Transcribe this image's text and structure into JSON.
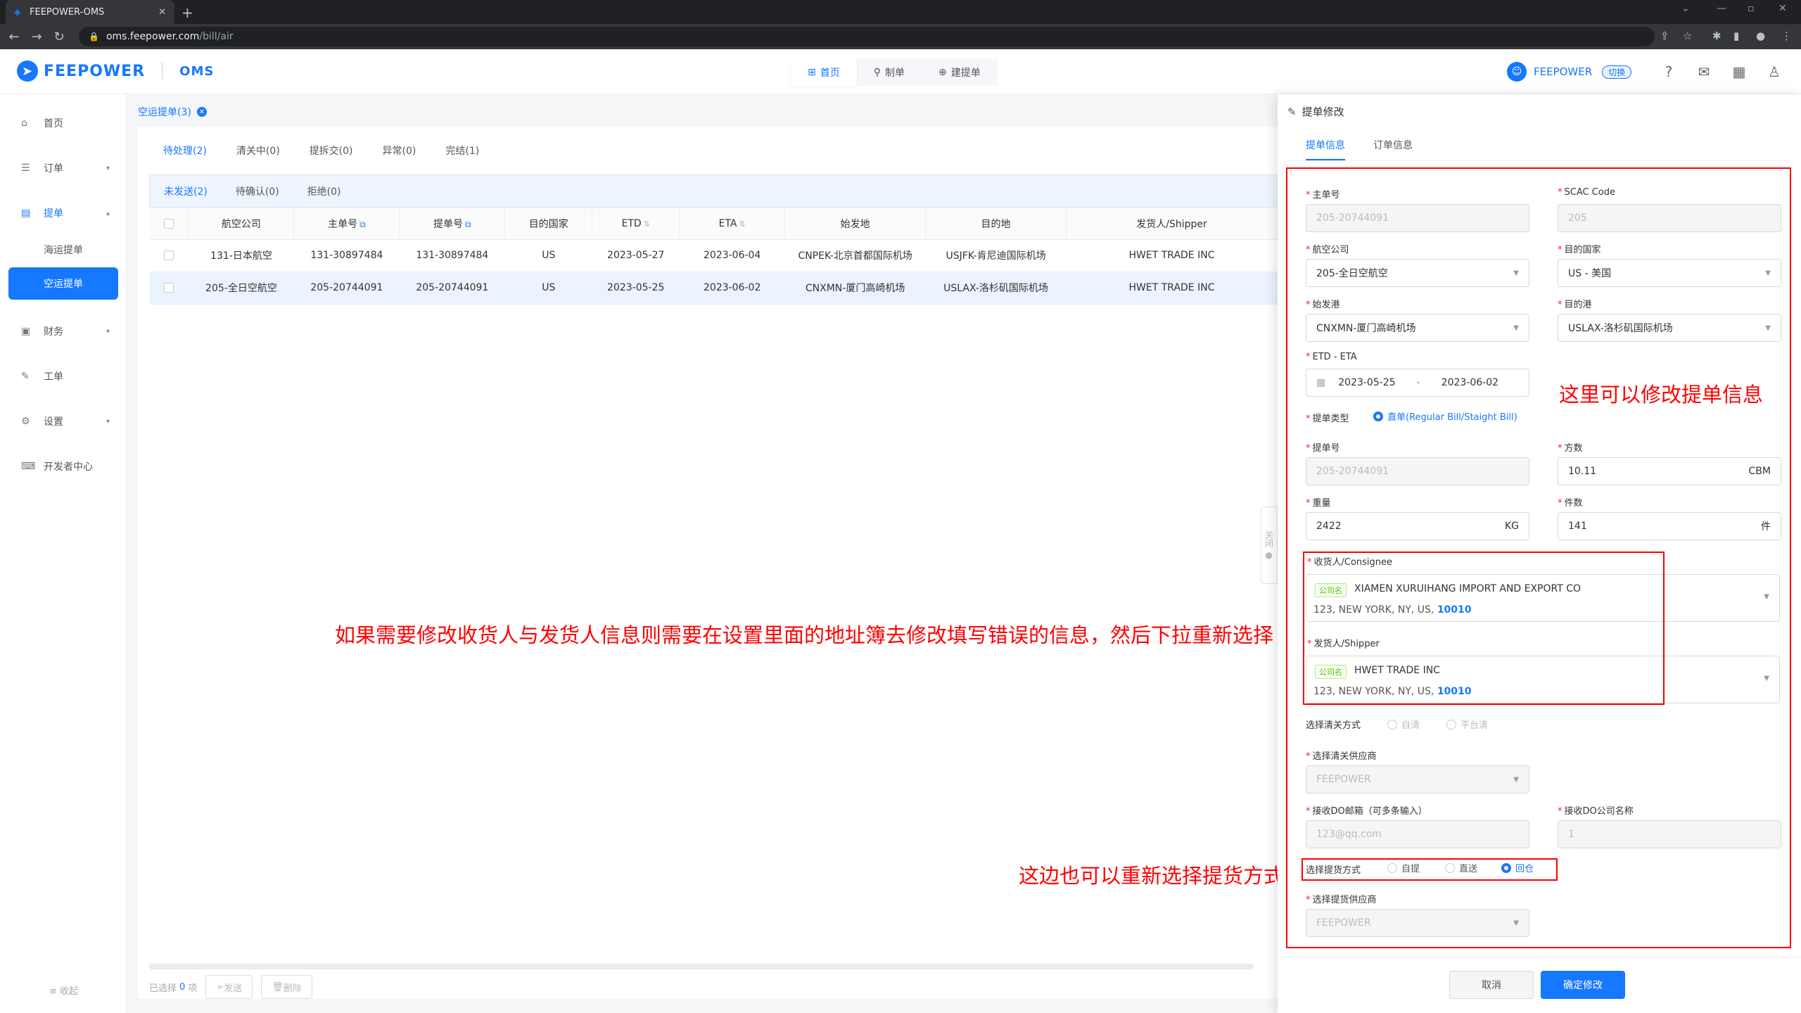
{
  "browser": {
    "tab_title": "FEEPOWER-OMS",
    "url_host": "oms.feepower.com",
    "url_path": "/bill/air"
  },
  "header": {
    "logo_text": "FEEPOWER",
    "product": "OMS",
    "nav": [
      {
        "label": "首页",
        "icon": "grid-icon"
      },
      {
        "label": "制单",
        "icon": "stamp-icon"
      },
      {
        "label": "建提单",
        "icon": "doc-plus-icon"
      }
    ],
    "user": "FEEPOWER",
    "switch_label": "切换"
  },
  "sidebar": {
    "items": [
      {
        "label": "首页"
      },
      {
        "label": "订单"
      },
      {
        "label": "提单"
      },
      {
        "label": "海运提单"
      },
      {
        "label": "空运提单"
      },
      {
        "label": "财务"
      },
      {
        "label": "工单"
      },
      {
        "label": "设置"
      },
      {
        "label": "开发者中心"
      }
    ],
    "collapse_label": "收起"
  },
  "page": {
    "tab_label": "空运提单(3)",
    "status_tabs": [
      "待处理(2)",
      "清关中(0)",
      "提拆交(0)",
      "异常(0)",
      "完结(1)"
    ],
    "sub_tabs": [
      "未发送(2)",
      "待确认(0)",
      "拒绝(0)"
    ]
  },
  "table": {
    "headers": [
      "航空公司",
      "主单号",
      "提单号",
      "目的国家",
      "ETD",
      "ETA",
      "始发地",
      "目的地",
      "发货人/Shipper"
    ],
    "rows": [
      [
        "131-日本航空",
        "131-30897484",
        "131-30897484",
        "US",
        "2023-05-27",
        "2023-06-04",
        "CNPEK-北京首都国际机场",
        "USJFK-肯尼迪国际机场",
        "HWET TRADE INC"
      ],
      [
        "205-全日空航空",
        "205-20744091",
        "205-20744091",
        "US",
        "2023-05-25",
        "2023-06-02",
        "CNXMN-厦门高崎机场",
        "USLAX-洛杉矶国际机场",
        "HWET TRADE INC"
      ]
    ]
  },
  "bottom": {
    "selected_prefix": "已选择",
    "selected_count": "0",
    "selected_suffix": "项",
    "send_label": "发送",
    "delete_label": "删除"
  },
  "annotations": {
    "middle": "如果需要修改收货人与发货人信息则需要在设置里面的地址簿去修改填写错误的信息，然后下拉重新选择",
    "bottom": "这边也可以重新选择提货方式",
    "right": "这里可以修改提单信息"
  },
  "drawer": {
    "title": "提单修改",
    "tabs": [
      "提单信息",
      "订单信息"
    ],
    "labels": {
      "master_no": "主单号",
      "scac": "SCAC Code",
      "airline": "航空公司",
      "dest_country": "目的国家",
      "origin_port": "始发港",
      "dest_port": "目的港",
      "etd_eta": "ETD - ETA",
      "bill_type": "提单类型",
      "bill_no": "提单号",
      "volume": "方数",
      "weight": "重量",
      "pieces": "件数",
      "consignee": "收货人/Consignee",
      "shipper": "发货人/Shipper",
      "customs_mode": "选择清关方式",
      "customs_vendor": "选择清关供应商",
      "do_email": "接收DO邮箱（可多条输入）",
      "do_company": "接收DO公司名称",
      "pickup_mode": "选择提货方式",
      "pickup_vendor": "选择提货供应商"
    },
    "values": {
      "master_no": "205-20744091",
      "scac": "205",
      "airline": "205-全日空航空",
      "dest_country": "US - 美国",
      "origin_port": "CNXMN-厦门高崎机场",
      "dest_port": "USLAX-洛杉矶国际机场",
      "etd": "2023-05-25",
      "eta": "2023-06-02",
      "bill_type": "直单(Regular Bill/Staight Bill)",
      "bill_no": "205-20744091",
      "volume": "10.11",
      "volume_unit": "CBM",
      "weight": "2422",
      "weight_unit": "KG",
      "pieces": "141",
      "pieces_unit": "件",
      "customs_vendor": "FEEPOWER",
      "do_email_placeholder": "123@qq.com",
      "do_company": "1",
      "pickup_vendor": "FEEPOWER"
    },
    "consignee": {
      "tag": "公司名",
      "name": "XIAMEN XURUIHANG IMPORT AND EXPORT CO",
      "address": "123, NEW YORK, NY, US,",
      "zip": "10010"
    },
    "shipper": {
      "tag": "公司名",
      "name": "HWET TRADE INC",
      "address": "123, NEW YORK, NY, US,",
      "zip": "10010"
    },
    "customs_options": [
      "自清",
      "平台清"
    ],
    "pickup_options": [
      "自提",
      "直送",
      "回仓"
    ],
    "cancel_label": "取消",
    "ok_label": "确定修改"
  },
  "colors": {
    "accent": "#1677ff",
    "annotation": "#ff0000"
  }
}
